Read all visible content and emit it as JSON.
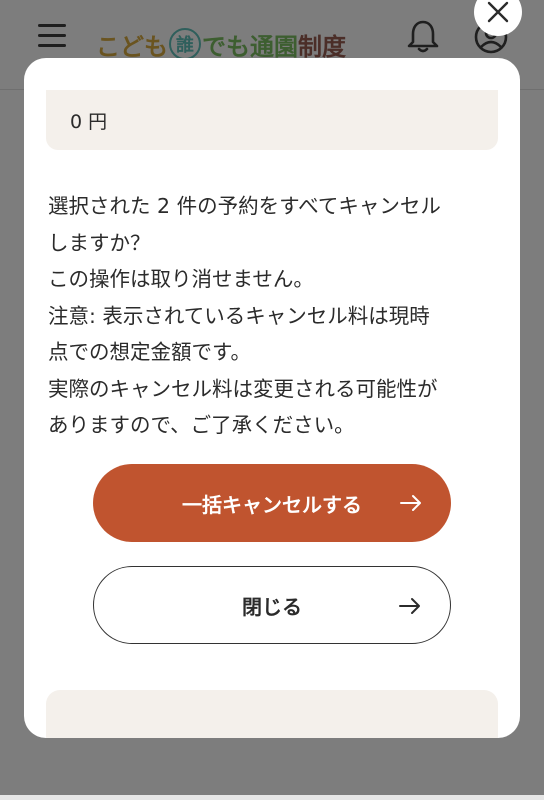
{
  "header": {
    "logo": {
      "part1": "こども",
      "circle_char": "誰",
      "part2": "でも通園",
      "part3": "制度"
    },
    "menu_icon": "hamburger-icon",
    "notification_icon": "bell-icon",
    "account_icon": "user-icon"
  },
  "modal": {
    "close_icon": "close-icon",
    "fee_value": "0 円",
    "message_lines": [
      "選択された 2 件の予約をすべてキャンセル",
      "しますか？",
      "この操作は取り消せません。",
      "注意: 表示されているキャンセル料は現時",
      "点での想定金額です。",
      "実際のキャンセル料は変更される可能性が",
      "ありますので、ご了承ください。"
    ],
    "primary_button": {
      "label": "一括キャンセルする",
      "icon": "arrow-right-icon"
    },
    "secondary_button": {
      "label": "閉じる",
      "icon": "arrow-right-icon"
    }
  },
  "colors": {
    "overlay": "#7d7d7d",
    "primary": "#c0542f",
    "surface": "#f4f0eb"
  }
}
